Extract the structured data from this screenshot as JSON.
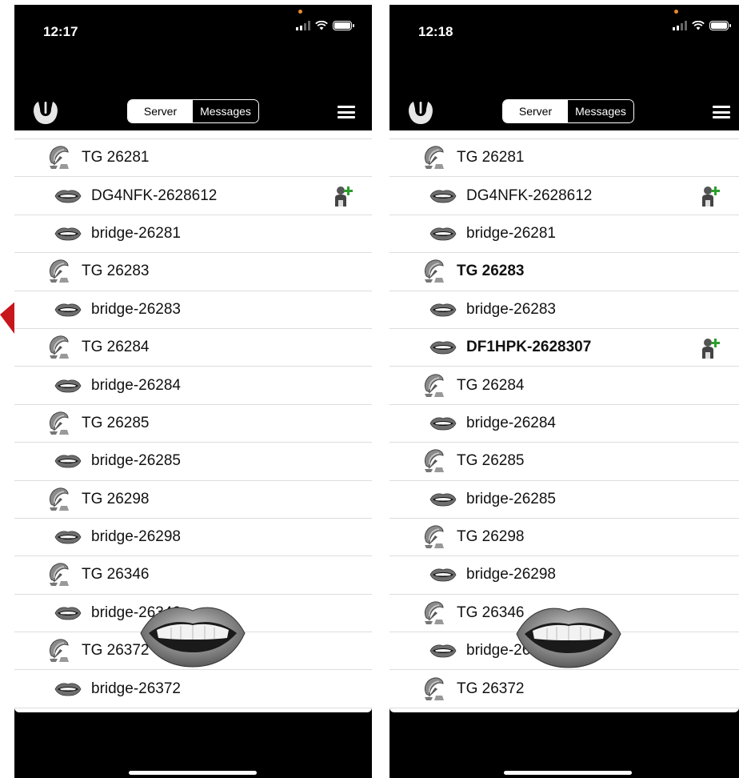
{
  "left": {
    "time": "12:17",
    "tabs": {
      "server": "Server",
      "messages": "Messages"
    },
    "rows": [
      {
        "label": "TG 26281",
        "kind": "talkgroup"
      },
      {
        "label": "DG4NFK-2628612",
        "kind": "user",
        "add_user": true
      },
      {
        "label": "bridge-26281",
        "kind": "user"
      },
      {
        "label": "TG 26283",
        "kind": "talkgroup"
      },
      {
        "label": "bridge-26283",
        "kind": "user"
      },
      {
        "label": "TG 26284",
        "kind": "talkgroup"
      },
      {
        "label": "bridge-26284",
        "kind": "user"
      },
      {
        "label": "TG 26285",
        "kind": "talkgroup"
      },
      {
        "label": "bridge-26285",
        "kind": "user"
      },
      {
        "label": "TG 26298",
        "kind": "talkgroup"
      },
      {
        "label": "bridge-26298",
        "kind": "user"
      },
      {
        "label": "TG 26346",
        "kind": "talkgroup"
      },
      {
        "label": "bridge-26346",
        "kind": "user"
      },
      {
        "label": "TG 26372",
        "kind": "talkgroup"
      },
      {
        "label": "bridge-26372",
        "kind": "user"
      }
    ]
  },
  "right": {
    "time": "12:18",
    "tabs": {
      "server": "Server",
      "messages": "Messages"
    },
    "rows": [
      {
        "label": "TG 26281",
        "kind": "talkgroup"
      },
      {
        "label": "DG4NFK-2628612",
        "kind": "user",
        "add_user": true
      },
      {
        "label": "bridge-26281",
        "kind": "user"
      },
      {
        "label": "TG 26283",
        "kind": "talkgroup",
        "bold": true
      },
      {
        "label": "bridge-26283",
        "kind": "user"
      },
      {
        "label": "DF1HPK-2628307",
        "kind": "user",
        "bold": true,
        "add_user": true
      },
      {
        "label": "TG 26284",
        "kind": "talkgroup"
      },
      {
        "label": "bridge-26284",
        "kind": "user"
      },
      {
        "label": "TG 26285",
        "kind": "talkgroup"
      },
      {
        "label": "bridge-26285",
        "kind": "user"
      },
      {
        "label": "TG 26298",
        "kind": "talkgroup"
      },
      {
        "label": "bridge-26298",
        "kind": "user"
      },
      {
        "label": "TG 26346",
        "kind": "talkgroup"
      },
      {
        "label": "bridge-26346",
        "kind": "user"
      },
      {
        "label": "TG 26372",
        "kind": "talkgroup"
      }
    ]
  },
  "icons": {
    "talkgroup": "satellite-dish-icon",
    "user": "mouth-icon",
    "add_user": "user-add-icon",
    "logo": "app-logo-icon",
    "menu": "hamburger-menu-icon",
    "speaking": "speaking-mouth-icon",
    "arrow": "red-arrow-annotation"
  },
  "colors": {
    "annotation_arrow": "#c8161d",
    "add_user_plus": "#2e9e2e",
    "status_dot": "#e88a2a"
  }
}
